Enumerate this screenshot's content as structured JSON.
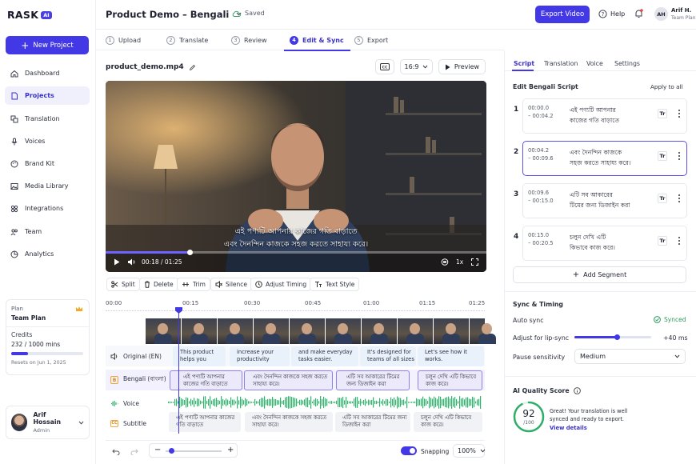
{
  "app": {
    "logo_text": "RASK",
    "logo_badge": "AI",
    "brand_color": "#4338e6"
  },
  "sidebar": {
    "new_project": "New Project",
    "items": [
      {
        "label": "Dashboard",
        "icon": "home-icon"
      },
      {
        "label": "Projects",
        "icon": "file-icon",
        "active": true
      },
      {
        "label": "Translation",
        "icon": "translate-icon"
      },
      {
        "label": "Voices",
        "icon": "microphone-icon"
      },
      {
        "label": "Brand Kit",
        "icon": "palette-icon"
      },
      {
        "label": "Media Library",
        "icon": "image-icon"
      },
      {
        "label": "Integrations",
        "icon": "grid-icon"
      },
      {
        "label": "Team",
        "icon": "team-icon"
      },
      {
        "label": "Analytics",
        "icon": "chart-icon"
      }
    ],
    "plan": {
      "label": "Plan",
      "name": "Team Plan",
      "credits_label": "Credits",
      "credits_value": "232 / 1000 mins",
      "credits_fraction": 0.232,
      "reset": "Resets on Jun 1, 2025"
    },
    "user": {
      "name": "Arif Hossain",
      "role": "Admin"
    }
  },
  "header": {
    "title": "Product Demo – Bengali",
    "saved": "Saved",
    "export": "Export Video",
    "help": "Help",
    "user_initials": "AH",
    "user_name": "Arif H.",
    "user_team": "Team Plan"
  },
  "steps": [
    {
      "n": "1",
      "label": "Upload"
    },
    {
      "n": "2",
      "label": "Translate"
    },
    {
      "n": "3",
      "label": "Review"
    },
    {
      "n": "4",
      "label": "Edit & Sync",
      "active": true
    },
    {
      "n": "5",
      "label": "Export"
    }
  ],
  "player": {
    "filename": "product_demo.mp4",
    "aspect": "16:9",
    "preview": "Preview",
    "subtitle_line1": "এই পণ্যটি আপনার কাজের গতি বাড়াতে",
    "subtitle_line2": "এবং দৈনন্দিন কাজকে সহজ করতে সাহায্য করে।",
    "time": "00:18 / 01:25",
    "speed": "1x",
    "progress": 0.22
  },
  "tools": [
    "Split",
    "Delete",
    "Trim",
    "Silence",
    "Adjust Timing",
    "Text Style"
  ],
  "timeline": {
    "ticks": [
      "00:00",
      "00:15",
      "00:30",
      "00:45",
      "01:00",
      "01:15",
      "01:25"
    ],
    "tracks": {
      "original": "Original (EN)",
      "bengali": "Bengali (বাংলা)",
      "voice": "Voice",
      "subtitle": "Subtitle"
    },
    "original_segments": [
      "This product helps you",
      "increase your productivity",
      "and make everyday tasks easier.",
      "It's designed for teams of all sizes",
      "Let's see how it works."
    ],
    "bengali_segments": [
      "এই পণ্যটি আপনার কাজের গতি বাড়াতে",
      "এবং দৈনন্দিন কাজকে সহজ করতে সাহায্য করে।",
      "এটি সব আকারের টিমের জন্য ডিজাইন করা",
      "চলুন দেখি এটি কিভাবে কাজ করে।"
    ],
    "subtitle_segments": [
      "এই পণ্যটি আপনার কাজের গতি বাড়াতে",
      "এবং দৈনন্দিন কাজকে সহজ করতে সাহায্য করে।",
      "এটি সব আকারের টিমের জন্য ডিজাইন করা",
      "চলুন দেখি এটি কিভাবে কাজ করে।"
    ],
    "snapping": "Snapping",
    "zoom": "100%"
  },
  "right_panel": {
    "tabs": [
      "Script",
      "Translation",
      "Voice",
      "Settings"
    ],
    "heading": "Edit Bengali Script",
    "apply_all": "Apply to all",
    "segments": [
      {
        "n": "1",
        "start": "00:00.0",
        "end": "– 00:04.2",
        "line1": "এই পণ্যটি আপনার",
        "line2": "কাজের গতি বাড়াতে"
      },
      {
        "n": "2",
        "start": "00:04.2",
        "end": "– 00:09.6",
        "line1": "এবং দৈনন্দিন কাজকে",
        "line2": "সহজ করতে সাহায্য করে।"
      },
      {
        "n": "3",
        "start": "00:09.6",
        "end": "– 00:15.0",
        "line1": "এটি সব আকারের",
        "line2": "টিমের জন্য ডিজাইন করা"
      },
      {
        "n": "4",
        "start": "00:15.0",
        "end": "– 00:20.5",
        "line1": "চলুন দেখি এটি",
        "line2": "কিভাবে কাজ করে।"
      }
    ],
    "tr_label": "Tr",
    "add_segment": "Add Segment",
    "sync_heading": "Sync & Timing",
    "auto_sync": "Auto sync",
    "synced": "Synced",
    "lipsync_label": "Adjust for lip-sync",
    "lipsync_value": "+40 ms",
    "lipsync_fraction": 0.55,
    "pause_label": "Pause sensitivity",
    "pause_value": "Medium",
    "ai_heading": "AI Quality Score",
    "score": "92",
    "score_max": "/100",
    "score_fraction": 0.92,
    "score_text1": "Great! Your translation is well",
    "score_text2": "synced and ready to export.",
    "view_details": "View details"
  }
}
